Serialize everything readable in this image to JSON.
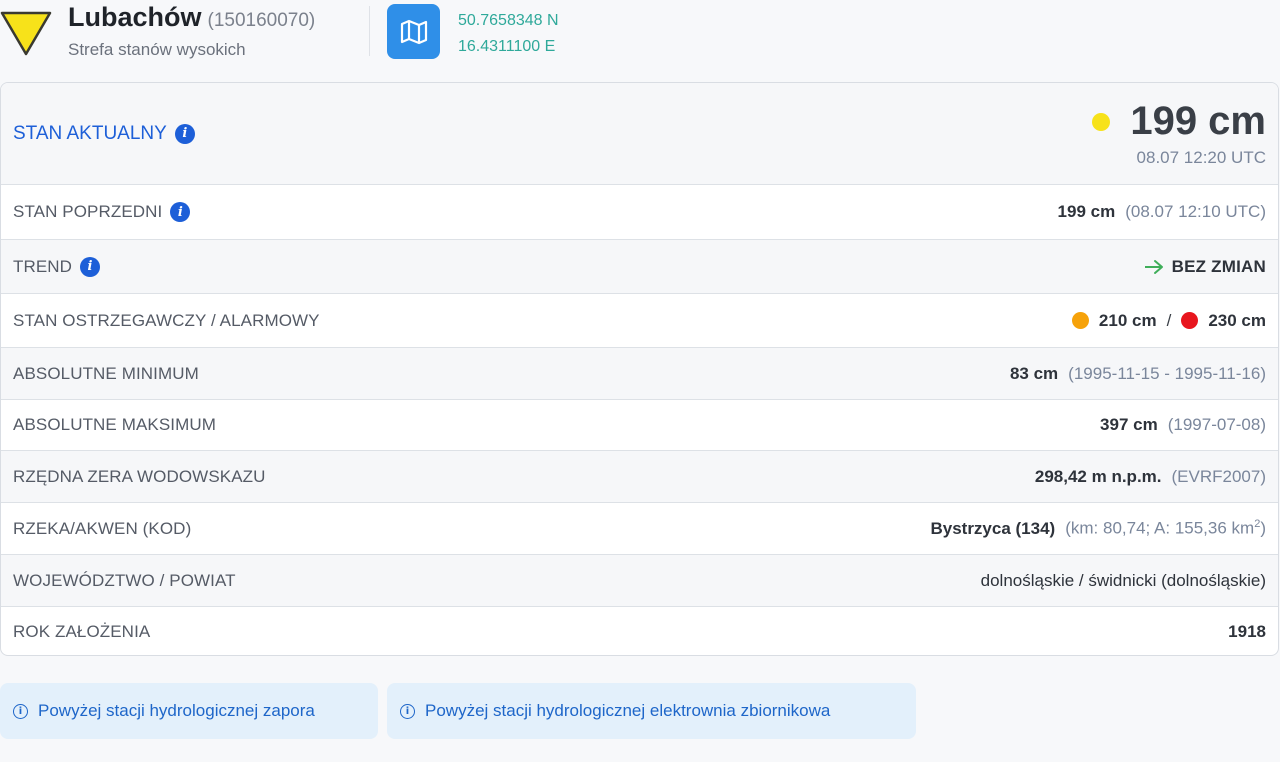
{
  "header": {
    "station_name": "Lubachów",
    "station_id": "(150160070)",
    "zone": "Strefa stanów wysokich",
    "latitude": "50.7658348 N",
    "longitude": "16.4311100 E",
    "warning_color": "#f7e21a",
    "map_icon": "map-icon"
  },
  "current": {
    "label": "STAN AKTUALNY",
    "level": "199 cm",
    "time": "08.07 12:20 UTC",
    "indicator_color": "#f7e21a"
  },
  "rows": {
    "previous": {
      "label": "STAN POPRZEDNI",
      "value": "199 cm",
      "extra": "(08.07 12:10 UTC)"
    },
    "trend": {
      "label": "TREND",
      "value": "BEZ ZMIAN",
      "icon": "arrow-right-icon"
    },
    "thresholds": {
      "label": "STAN OSTRZEGAWCZY / ALARMOWY",
      "warning": "210 cm",
      "separator": "/",
      "alarm": "230 cm",
      "warning_color": "#f6a20a",
      "alarm_color": "#e8161e"
    },
    "abs_min": {
      "label": "ABSOLUTNE MINIMUM",
      "value": "83 cm",
      "extra": "(1995-11-15 - 1995-11-16)"
    },
    "abs_max": {
      "label": "ABSOLUTNE MAKSIMUM",
      "value": "397 cm",
      "extra": "(1997-07-08)"
    },
    "zero": {
      "label": "RZĘDNA ZERA WODOWSKAZU",
      "value": "298,42 m n.p.m.",
      "extra": "(EVRF2007)"
    },
    "river": {
      "label": "RZEKA/AKWEN (KOD)",
      "value": "Bystrzyca (134)",
      "extra": "(km: 80,74; A: 155,36 km",
      "extra_sup": "2",
      "extra_end": ")"
    },
    "region": {
      "label": "WOJEWÓDZTWO / POWIAT",
      "value": "dolnośląskie / świdnicki (dolnośląskie)"
    },
    "founded": {
      "label": "ROK ZAŁOŻENIA",
      "value": "1918"
    }
  },
  "notices": [
    {
      "text": "Powyżej stacji hydrologicznej zapora"
    },
    {
      "text": "Powyżej stacji hydrologicznej elektrownia zbiornikowa"
    }
  ]
}
